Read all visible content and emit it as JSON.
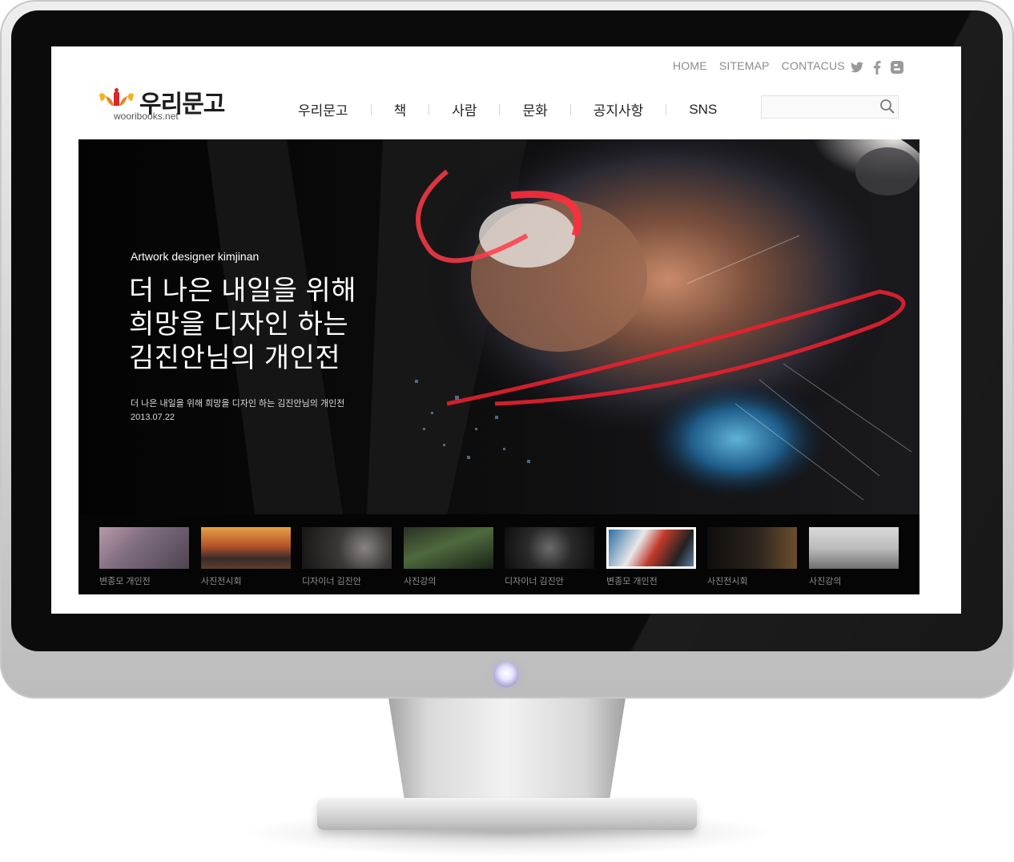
{
  "util_nav": [
    "HOME",
    "SITEMAP",
    "CONTACUS"
  ],
  "social": [
    {
      "icon": "twitter-icon"
    },
    {
      "icon": "facebook-icon"
    },
    {
      "icon": "blogger-icon"
    }
  ],
  "logo": {
    "text": "우리문고",
    "domain": "wooribooks.net"
  },
  "main_nav": [
    "우리문고",
    "책",
    "사람",
    "문화",
    "공지사항",
    "SNS"
  ],
  "search": {
    "value": "",
    "placeholder": ""
  },
  "hero": {
    "subtitle": "Artwork designer kimjinan",
    "title_lines": [
      "더 나은 내일을 위해",
      "희망을 디자인 하는",
      "김진안님의 개인전"
    ],
    "description": "더 나은 내일을 위해 희망을 디자인 하는 김진안님의 개인전",
    "date": "2013.07.22"
  },
  "thumbnails": [
    {
      "label": "변종모 개인전",
      "active": false
    },
    {
      "label": "사진전시회",
      "active": false
    },
    {
      "label": "디자이너 김진안",
      "active": false
    },
    {
      "label": "사진강의",
      "active": false
    },
    {
      "label": "디자이너 김진안",
      "active": false
    },
    {
      "label": "변종모 개인전",
      "active": true
    },
    {
      "label": "사진전시회",
      "active": false
    },
    {
      "label": "사진강의",
      "active": false
    }
  ],
  "colors": {
    "accent": "#ee7d1b",
    "logo_red": "#d8262c",
    "logo_yellow": "#f2b21b"
  }
}
